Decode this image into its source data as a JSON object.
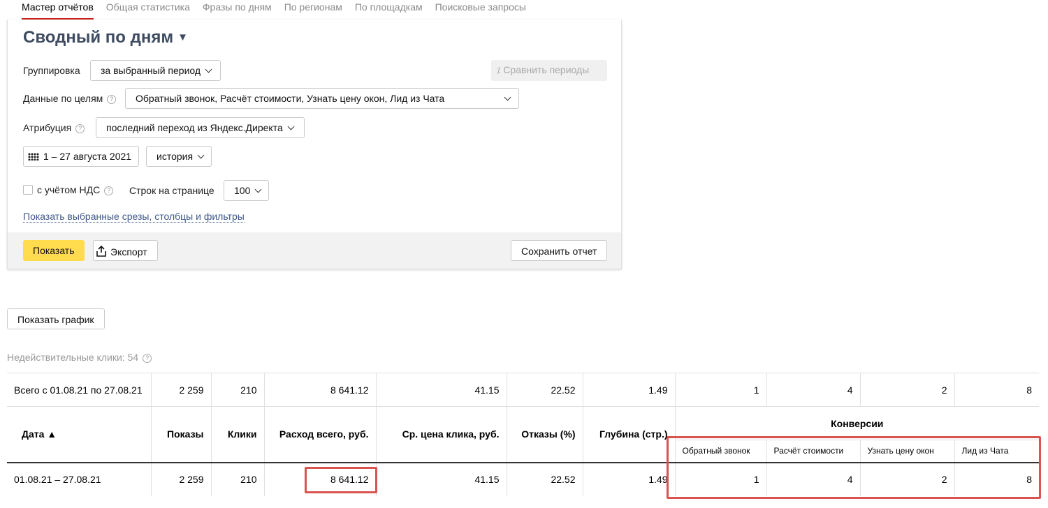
{
  "tabs": [
    "Мастер отчётов",
    "Общая статистика",
    "Фразы по дням",
    "По регионам",
    "По площадкам",
    "Поисковые запросы"
  ],
  "report": {
    "title": "Сводный по дням",
    "grouping_label": "Группировка",
    "grouping_value": "за выбранный период",
    "compare_label": "Сравнить периоды",
    "goals_label": "Данные по целям",
    "goals_value": "Обратный звонок, Расчёт стоимости, Узнать цену окон, Лид из Чата",
    "attribution_label": "Атрибуция",
    "attribution_value": "последний переход из Яндекс.Директа",
    "period_value": "1 – 27 августа 2021",
    "history_value": "история",
    "vat_label": "с учётом НДС",
    "rows_label": "Строк на странице",
    "rows_value": "100",
    "show_filters_link": "Показать выбранные срезы, столбцы и фильтры",
    "show_button": "Показать",
    "export_button": "Экспорт",
    "save_button": "Сохранить отчет"
  },
  "show_chart_button": "Показать график",
  "invalid_clicks": "Недействительные клики: 54",
  "table": {
    "total_row": [
      "Всего с 01.08.21 по 27.08.21",
      "2 259",
      "210",
      "8 641.12",
      "41.15",
      "22.52",
      "1.49",
      "1",
      "4",
      "2",
      "8"
    ],
    "headers": [
      "Дата ▲",
      "Показы",
      "Клики",
      "Расход всего, руб.",
      "Ср. цена клика, руб.",
      "Отказы (%)",
      "Глубина (стр.)"
    ],
    "conversions_header": "Конверсии",
    "conversion_goals": [
      "Обратный звонок",
      "Расчёт стоимости",
      "Узнать цену окон",
      "Лид из Чата"
    ],
    "rows": [
      [
        "01.08.21 – 27.08.21",
        "2 259",
        "210",
        "8 641.12",
        "41.15",
        "22.52",
        "1.49",
        "1",
        "4",
        "2",
        "8"
      ]
    ]
  },
  "colors": {
    "accent_tab": "#c8201f",
    "title": "#3e4b60",
    "primary_button": "#ffdb4d",
    "highlight": "#d9534f",
    "link": "#3f5a8a"
  }
}
